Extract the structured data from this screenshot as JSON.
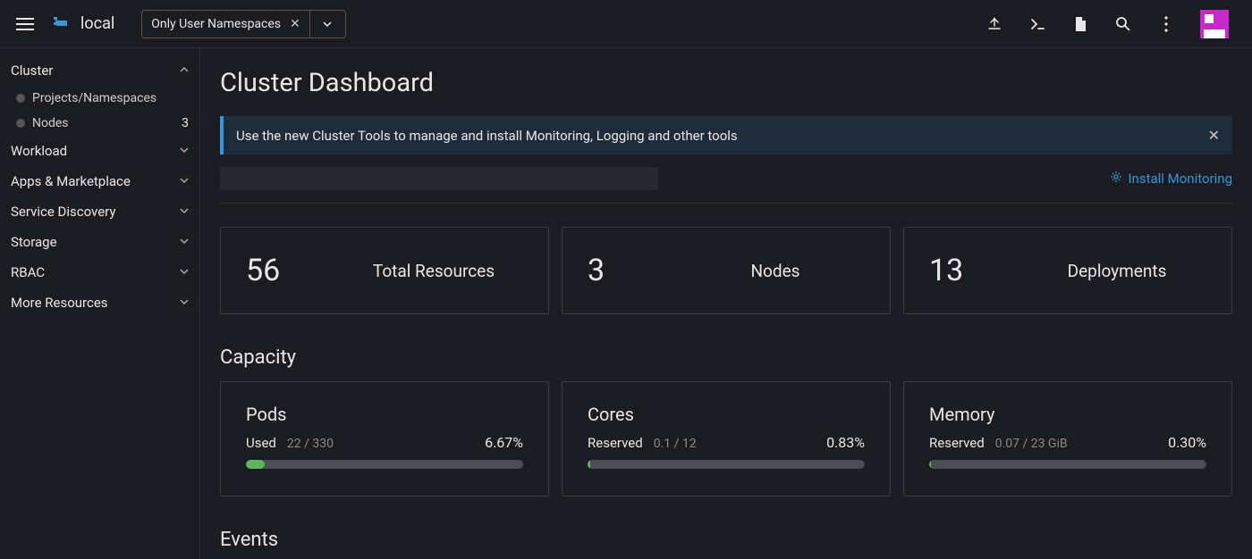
{
  "header": {
    "logo_text": "local",
    "namespace_filter": "Only User Namespaces"
  },
  "sidebar": {
    "cluster_label": "Cluster",
    "projects_label": "Projects/Namespaces",
    "nodes_label": "Nodes",
    "nodes_count": "3",
    "items": [
      {
        "label": "Workload"
      },
      {
        "label": "Apps & Marketplace"
      },
      {
        "label": "Service Discovery"
      },
      {
        "label": "Storage"
      },
      {
        "label": "RBAC"
      },
      {
        "label": "More Resources"
      }
    ]
  },
  "page": {
    "title": "Cluster Dashboard",
    "banner": "Use the new Cluster Tools to manage and install Monitoring, Logging and other tools",
    "install_monitoring": "Install Monitoring",
    "stats": [
      {
        "value": "56",
        "label": "Total Resources"
      },
      {
        "value": "3",
        "label": "Nodes"
      },
      {
        "value": "13",
        "label": "Deployments"
      }
    ],
    "capacity_title": "Capacity",
    "capacity": [
      {
        "title": "Pods",
        "status_label": "Used",
        "sub": "22 / 330",
        "pct": "6.67%",
        "pct_num": 6.67
      },
      {
        "title": "Cores",
        "status_label": "Reserved",
        "sub": "0.1 / 12",
        "pct": "0.83%",
        "pct_num": 0.83
      },
      {
        "title": "Memory",
        "status_label": "Reserved",
        "sub": "0.07 / 23 GiB",
        "pct": "0.30%",
        "pct_num": 0.3
      }
    ],
    "events_title": "Events"
  }
}
